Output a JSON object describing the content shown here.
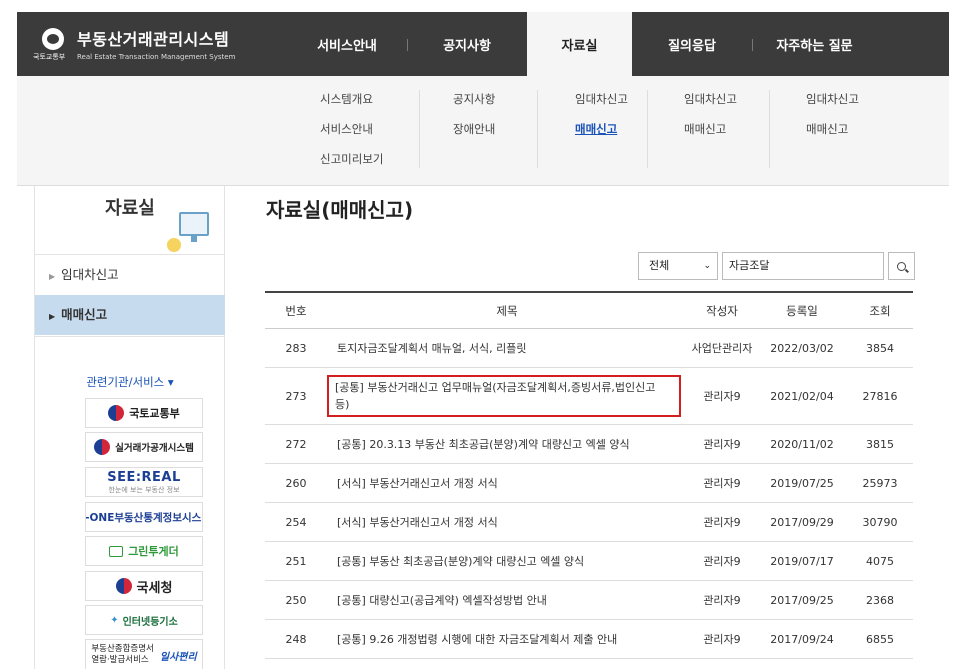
{
  "header": {
    "brand_title": "부동산거래관리시스템",
    "brand_subtitle": "Real Estate Transaction Management System",
    "ministry_label": "국토교통부",
    "nav": [
      "서비스안내",
      "공지사항",
      "자료실",
      "질의응답",
      "자주하는 질문"
    ]
  },
  "submenu": {
    "col1": [
      "시스템개요",
      "서비스안내",
      "신고미리보기"
    ],
    "col2": [
      "공지사항",
      "장애안내"
    ],
    "col3": [
      "임대차신고",
      "매매신고"
    ],
    "col4": [
      "임대차신고",
      "매매신고"
    ],
    "col5": [
      "임대차신고",
      "매매신고"
    ]
  },
  "sidebar": {
    "title": "자료실",
    "items": [
      "임대차신고",
      "매매신고"
    ],
    "related_label": "관련기관/서비스 ▾",
    "partners": {
      "molit": "국토교통부",
      "rtms": "실거래가공개시스템",
      "seereal": "SEE:REAL",
      "seereal_sub": "한눈에 보는 부동산 정보",
      "rone": "R-ONE부동산통계정보시스템",
      "green": "그린투게더",
      "nts": "국세청",
      "iros": "인터넷등기소",
      "cert_line1": "부동산종합증명서",
      "cert_line2": "열람·발급서비스",
      "cert_brand": "일사편리"
    }
  },
  "main": {
    "page_title": "자료실(매매신고)",
    "search": {
      "scope": "전체",
      "query": "자금조달"
    },
    "columns": [
      "번호",
      "제목",
      "작성자",
      "등록일",
      "조회"
    ],
    "rows": [
      {
        "no": "283",
        "title": "토지자금조달계획서 매뉴얼, 서식, 리플릿",
        "author": "사업단관리자",
        "date": "2022/03/02",
        "views": "3854"
      },
      {
        "no": "273",
        "title": "[공통] 부동산거래신고 업무매뉴얼(자금조달계획서,증빙서류,법인신고 등)",
        "author": "관리자9",
        "date": "2021/02/04",
        "views": "27816"
      },
      {
        "no": "272",
        "title": "[공통] 20.3.13 부동산 최초공급(분양)계약 대량신고 엑셀 양식",
        "author": "관리자9",
        "date": "2020/11/02",
        "views": "3815"
      },
      {
        "no": "260",
        "title": "[서식] 부동산거래신고서 개정 서식",
        "author": "관리자9",
        "date": "2019/07/25",
        "views": "25973"
      },
      {
        "no": "254",
        "title": "[서식] 부동산거래신고서 개정 서식",
        "author": "관리자9",
        "date": "2017/09/29",
        "views": "30790"
      },
      {
        "no": "251",
        "title": "[공통] 부동산 최초공급(분양)계약 대량신고 엑셀 양식",
        "author": "관리자9",
        "date": "2019/07/17",
        "views": "4075"
      },
      {
        "no": "250",
        "title": "[공통] 대량신고(공급계약) 엑셀작성방법 안내",
        "author": "관리자9",
        "date": "2017/09/25",
        "views": "2368"
      },
      {
        "no": "248",
        "title": "[공통] 9.26 개정법령 시행에 대한 자금조달계획서 제출 안내",
        "author": "관리자9",
        "date": "2017/09/24",
        "views": "6855"
      }
    ]
  },
  "colors": {
    "header_bg": "#3b3b3b",
    "active_side": "#c7dbef",
    "link_blue": "#1a53b8",
    "highlight_red": "#d22020"
  }
}
